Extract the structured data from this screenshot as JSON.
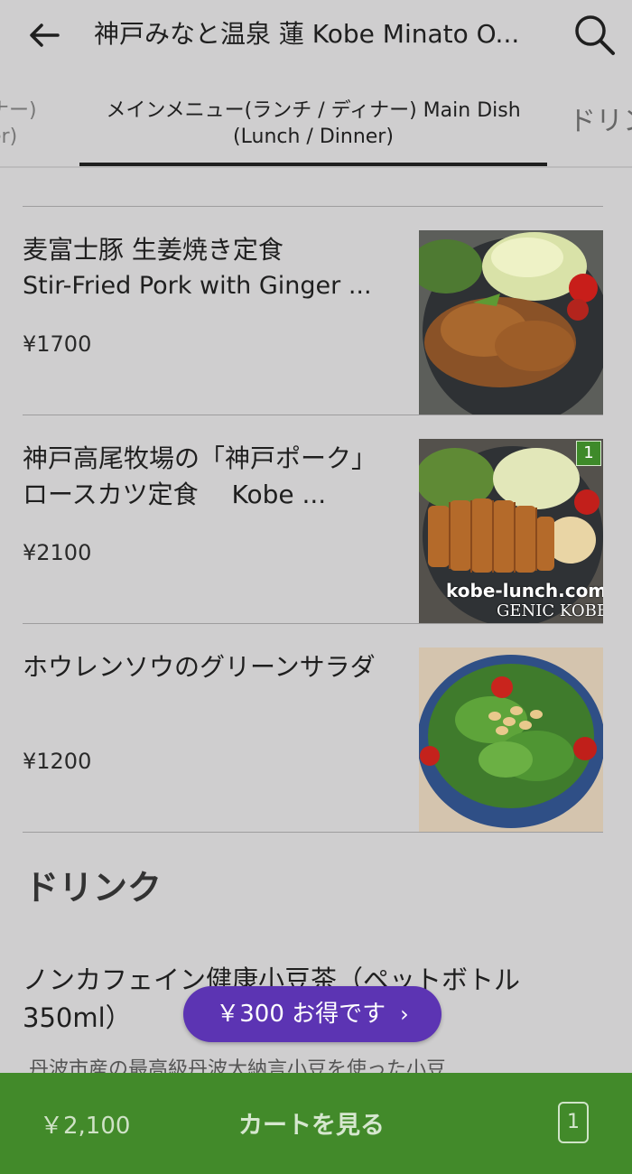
{
  "header": {
    "title": "神戸みなと温泉 蓮 Kobe Minato O..."
  },
  "tabs": {
    "left_line1": "ナー)",
    "left_line2": "er)",
    "active": "メインメニュー(ランチ / ディナー) Main Dish (Lunch / Dinner)",
    "right": "ドリン"
  },
  "items": [
    {
      "name_ja": "麦富士豚 生姜焼き定食",
      "name_en": "Stir-Fried Pork with Ginger ...",
      "price": "¥1700"
    },
    {
      "name_ja": "神戸高尾牧場の「神戸ポーク」ロースカツ定食　 Kobe ...",
      "price": "¥2100",
      "badge": "1",
      "watermark1": "kobe-lunch.com",
      "watermark2": "GENIC KOBE"
    },
    {
      "name_ja": "ホウレンソウのグリーンサラダ",
      "price": "¥1200"
    }
  ],
  "section": {
    "title": "ドリンク"
  },
  "drink": {
    "name": "ノンカフェイン健康小豆茶（ペットボトル350ml）",
    "description": "丹波市産の最高級丹波大納言小豆を使った小豆"
  },
  "promo": {
    "label": "￥300 お得です",
    "chevron": "›"
  },
  "cart": {
    "total": "￥2,100",
    "label": "カートを見る",
    "count": "1"
  },
  "colors": {
    "background": "#cfcecf",
    "cart_bar": "#428a2a",
    "promo": "#5c34b3"
  },
  "icons": {
    "back": "arrow-left-icon",
    "search": "search-icon"
  }
}
